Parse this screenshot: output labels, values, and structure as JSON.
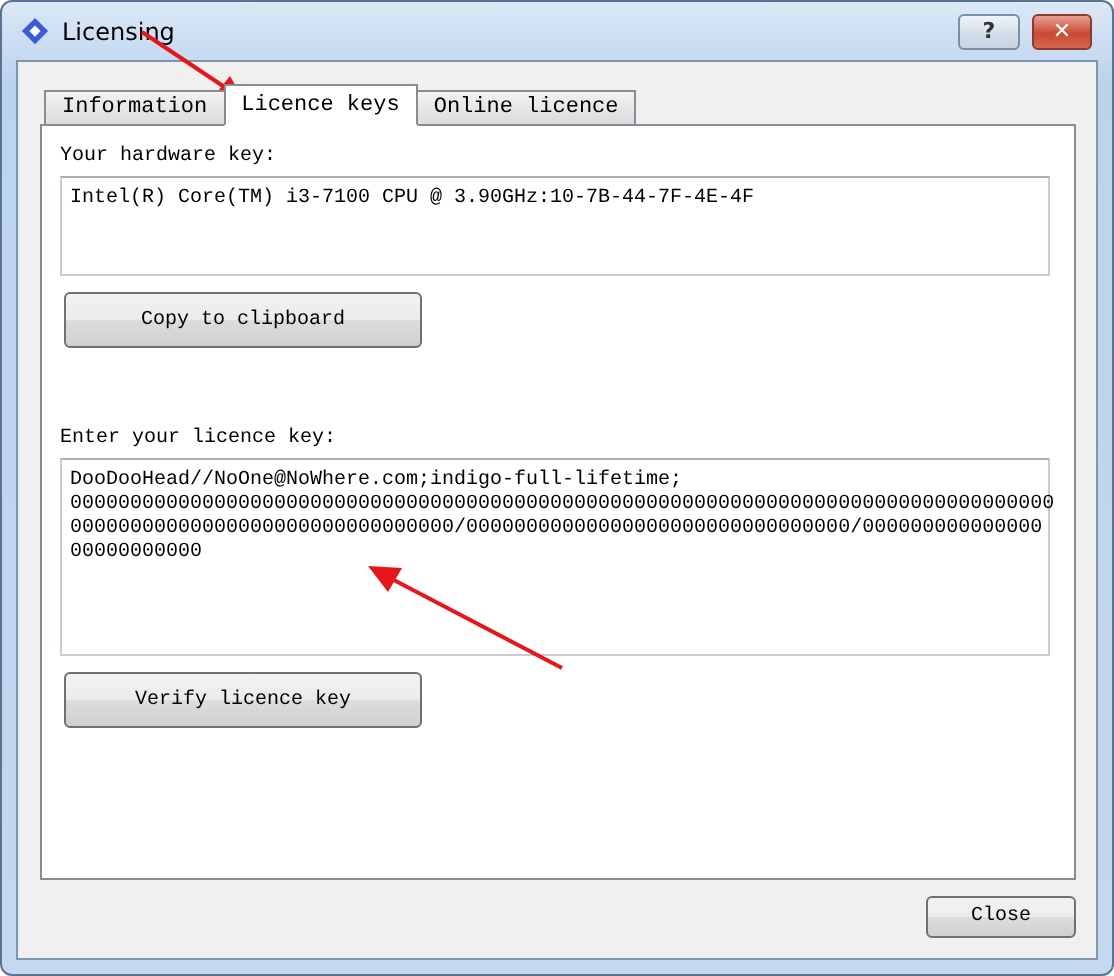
{
  "window": {
    "title": "Licensing",
    "help_button": "?",
    "close_button": "✕"
  },
  "tabs": [
    {
      "label": "Information",
      "selected": false
    },
    {
      "label": "Licence keys",
      "selected": true
    },
    {
      "label": "Online licence",
      "selected": false
    }
  ],
  "hardware_key": {
    "label": "Your hardware key:",
    "value": "Intel(R) Core(TM) i3-7100 CPU @ 3.90GHz:10-7B-44-7F-4E-4F"
  },
  "copy_button": "Copy to clipboard",
  "licence_key": {
    "label": "Enter your licence key:",
    "lines": [
      "DooDooHead//NoOne@NoWhere.com;indigo-full-lifetime;",
      "0000000000000000000000000000000000000000000000000000000000000000000000000000000000",
      "00000000000000000000000000000000/00000000000000000000000000000000/000000000000000",
      "00000000000"
    ]
  },
  "verify_button": "Verify licence key",
  "close_button": "Close",
  "annotations": [
    {
      "kind": "arrow"
    },
    {
      "kind": "arrow"
    }
  ]
}
